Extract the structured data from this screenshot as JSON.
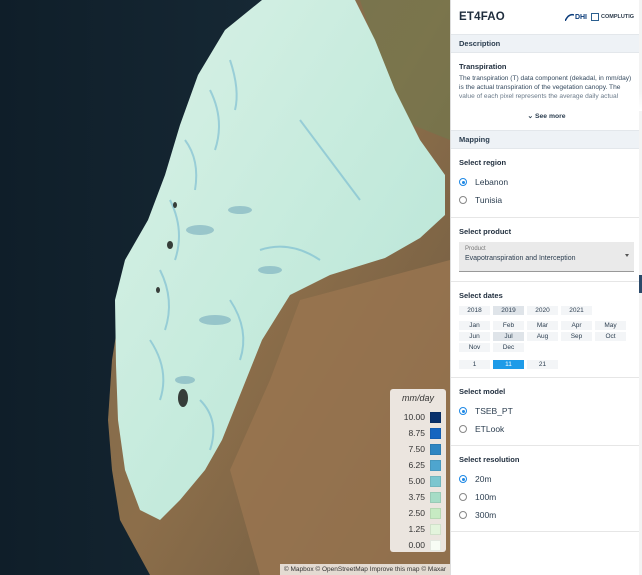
{
  "map": {
    "legend": {
      "title": "mm/day",
      "entries": [
        {
          "label": "10.00",
          "color": "#08306b"
        },
        {
          "label": "8.75",
          "color": "#1565c0"
        },
        {
          "label": "7.50",
          "color": "#2f86c2"
        },
        {
          "label": "6.25",
          "color": "#4ea5cf"
        },
        {
          "label": "5.00",
          "color": "#7cc6cf"
        },
        {
          "label": "3.75",
          "color": "#a6dcc6"
        },
        {
          "label": "2.50",
          "color": "#c7ebc3"
        },
        {
          "label": "1.25",
          "color": "#e3f4dc"
        },
        {
          "label": "0.00",
          "color": "#f7fcf5"
        }
      ]
    },
    "attribution": "© Mapbox © OpenStreetMap Improve this map © Maxar"
  },
  "panel": {
    "app_title": "ET4FAO",
    "logo_dhi": "DHI",
    "logo_compl": "COMPLUTIG",
    "description_header": "Description",
    "description_title": "Transpiration",
    "description_text": "The transpiration (T) data component (dekadal, in mm/day) is the actual transpiration of the vegetation canopy. The value of each pixel represents the average daily actual",
    "see_more": "See more",
    "mapping_header": "Mapping",
    "region": {
      "title": "Select region",
      "options": [
        {
          "label": "Lebanon",
          "checked": true
        },
        {
          "label": "Tunisia",
          "checked": false
        }
      ]
    },
    "product": {
      "title": "Select product",
      "field_label": "Product",
      "value": "Evapotranspiration and Interception"
    },
    "dates": {
      "title": "Select dates",
      "years": [
        "2018",
        "2019",
        "2020",
        "2021"
      ],
      "active_year": "2019",
      "months": [
        "Jan",
        "Feb",
        "Mar",
        "Apr",
        "May",
        "Jun",
        "Jul",
        "Aug",
        "Sep",
        "Oct",
        "Nov",
        "Dec"
      ],
      "active_month": "Jul",
      "days": [
        "1",
        "11",
        "21"
      ],
      "selected_day": "11"
    },
    "model": {
      "title": "Select model",
      "options": [
        {
          "label": "TSEB_PT",
          "checked": true
        },
        {
          "label": "ETLook",
          "checked": false
        }
      ]
    },
    "resolution": {
      "title": "Select resolution",
      "options": [
        {
          "label": "20m",
          "checked": true
        },
        {
          "label": "100m",
          "checked": false
        },
        {
          "label": "300m",
          "checked": false
        }
      ]
    }
  }
}
